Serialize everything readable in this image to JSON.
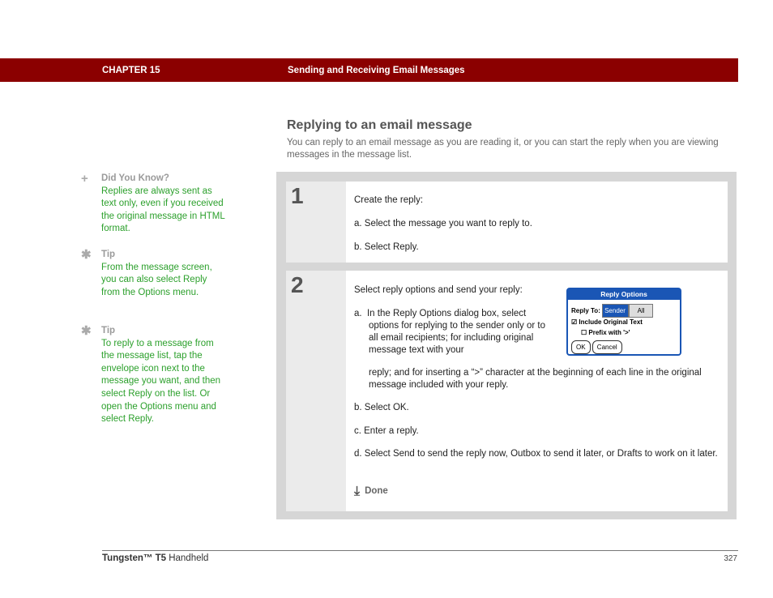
{
  "header": {
    "chapter": "CHAPTER 15",
    "title": "Sending and Receiving Email Messages",
    "bar_color": "#8b0000"
  },
  "section": {
    "title": "Replying to an email message",
    "intro": "You can reply to an email message as you are reading it, or you can start the reply when you are viewing messages in the message list."
  },
  "sidebar": [
    {
      "icon": "plus-icon",
      "glyph": "+",
      "heading": "Did You Know?",
      "body": "Replies are always sent as text only, even if you received the original message in HTML format."
    },
    {
      "icon": "asterisk-icon",
      "glyph": "✱",
      "heading": "Tip",
      "body": "From the message screen, you can also select Reply from the Options menu."
    },
    {
      "icon": "asterisk-icon",
      "glyph": "✱",
      "heading": "Tip",
      "body": "To reply to a message from the message list, tap the envelope icon next to the message you want, and then select Reply on the list. Or open the Options menu and select Reply."
    }
  ],
  "steps": [
    {
      "number": "1",
      "intro": "Create the reply:",
      "items": [
        "a.  Select the message you want to reply to.",
        "b.  Select Reply."
      ]
    },
    {
      "number": "2",
      "intro": "Select reply options and send your reply:",
      "items": [
        "a.  In the Reply Options dialog box, select options for replying to the sender only or to all email recipients; for including original message text with your reply; and for inserting a “>” character at the beginning of each line in the original message included with your reply.",
        "b.  Select OK.",
        "c.  Enter a reply.",
        "d.  Select Send to send the reply now, Outbox to send it later, or Drafts to work on it later."
      ],
      "done": "Done"
    }
  ],
  "dialog": {
    "title": "Reply Options",
    "reply_to_label": "Reply To:",
    "options": [
      "Sender",
      "All"
    ],
    "selected": "Sender",
    "include_original": {
      "label": "Include Original Text",
      "checked": true,
      "glyph": "☑"
    },
    "prefix": {
      "label": "Prefix with '>'",
      "checked": false,
      "glyph": "☐"
    },
    "ok": "OK",
    "cancel": "Cancel"
  },
  "footer": {
    "product_bold": "Tungsten™ T5",
    "product_rest": " Handheld",
    "page": "327"
  }
}
